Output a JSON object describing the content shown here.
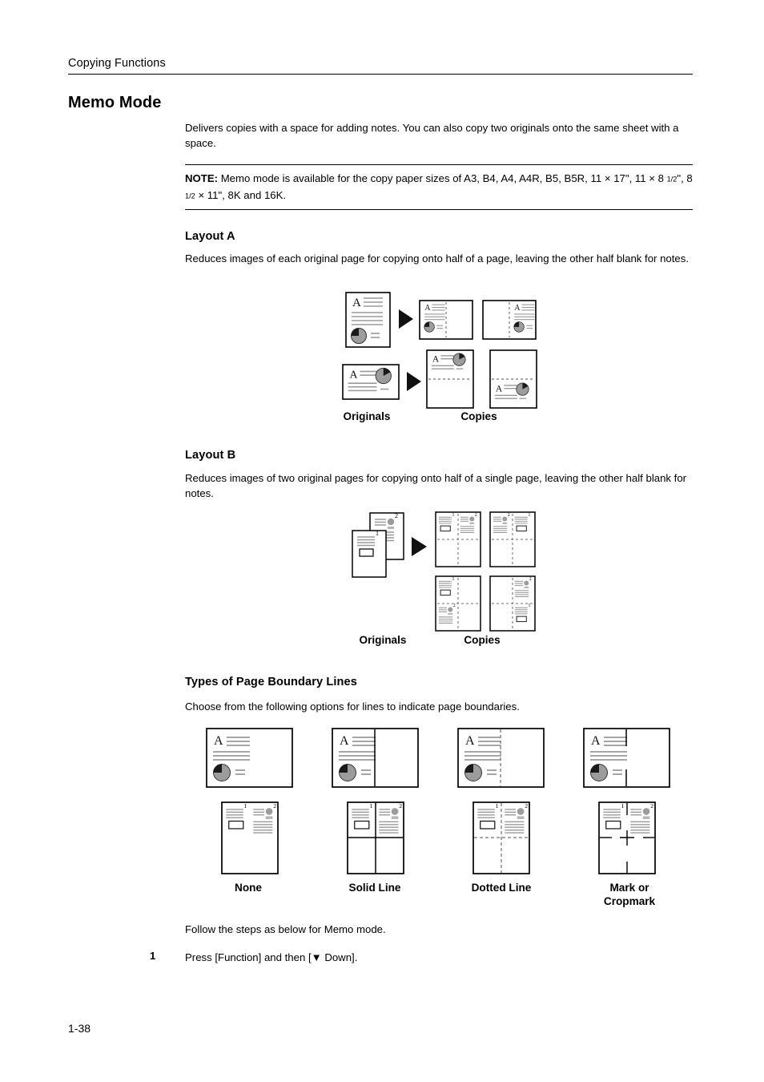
{
  "header": {
    "running_head": "Copying Functions"
  },
  "title": "Memo Mode",
  "intro": "Delivers copies with a space for adding notes. You can also copy two originals onto the same sheet with a space.",
  "note": {
    "label": "NOTE:",
    "text_part1": " Memo mode is available for the copy paper sizes of A3, B4, A4, A4R, B5, B5R, 11 × 17\", 11 × 8 ",
    "frac1": "1/2",
    "text_part2": "\", 8 ",
    "frac2": "1/2",
    "text_part3": " × 11\", 8K and 16K."
  },
  "layout_a": {
    "heading": "Layout A",
    "description": "Reduces images of each original page for copying onto half of a page, leaving the other half blank for notes.",
    "label_originals": "Originals",
    "label_copies": "Copies"
  },
  "layout_b": {
    "heading": "Layout B",
    "description": "Reduces images of two original pages for copying onto half of a single page, leaving the other half blank for notes.",
    "label_originals": "Originals",
    "label_copies": "Copies"
  },
  "boundary": {
    "heading": "Types of Page Boundary Lines",
    "description": "Choose from the following options for lines to indicate page boundaries.",
    "options": [
      {
        "label": "None"
      },
      {
        "label": "Solid Line"
      },
      {
        "label": "Dotted Line"
      },
      {
        "label": "Mark or\nCropmark"
      }
    ]
  },
  "procedure": {
    "intro": "Follow the steps as below for Memo mode.",
    "steps": [
      {
        "num": "1",
        "text": "Press [Function] and then [▼ Down]."
      }
    ]
  },
  "footer": {
    "page_number": "1-38"
  },
  "colors": {
    "text": "#000000",
    "page_background": "#ffffff",
    "line_gray": "#9a9a9a",
    "pie_gray": "#9c9c9c",
    "pie_dark": "#1a1a1a",
    "dash_gray": "#8c8c8c"
  }
}
